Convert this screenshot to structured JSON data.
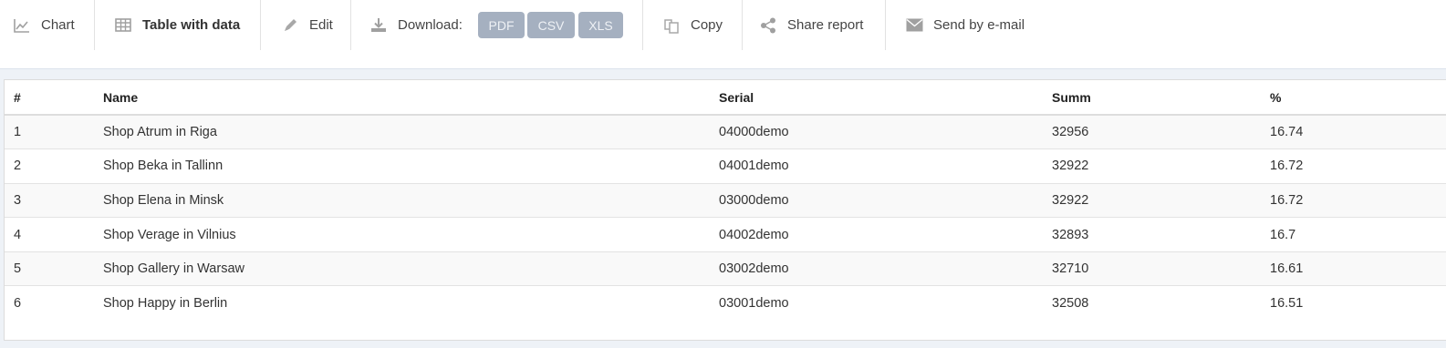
{
  "toolbar": {
    "chart_label": "Chart",
    "table_label": "Table with data",
    "edit_label": "Edit",
    "download_label": "Download:",
    "formats": [
      "PDF",
      "CSV",
      "XLS"
    ],
    "copy_label": "Copy",
    "share_label": "Share report",
    "email_label": "Send by e-mail",
    "icons": [
      "line-chart-icon",
      "table-icon",
      "pencil-icon",
      "download-icon",
      "copy-icon",
      "share-icon",
      "envelope-icon"
    ]
  },
  "table": {
    "columns": [
      "#",
      "Name",
      "Serial",
      "Summ",
      "%"
    ],
    "rows": [
      [
        "1",
        "Shop Atrum in Riga",
        "04000demo",
        "32956",
        "16.74"
      ],
      [
        "2",
        "Shop Beka in Tallinn",
        "04001demo",
        "32922",
        "16.72"
      ],
      [
        "3",
        "Shop Elena in Minsk",
        "03000demo",
        "32922",
        "16.72"
      ],
      [
        "4",
        "Shop Verage in Vilnius",
        "04002demo",
        "32893",
        "16.7"
      ],
      [
        "5",
        "Shop Gallery in Warsaw",
        "03002demo",
        "32710",
        "16.61"
      ],
      [
        "6",
        "Shop Happy in Berlin",
        "03001demo",
        "32508",
        "16.51"
      ]
    ]
  },
  "colors": {
    "pill_bg": "#a5b0c0",
    "band_bg": "#eef2f7",
    "icon_gray": "#a0a0a0"
  }
}
